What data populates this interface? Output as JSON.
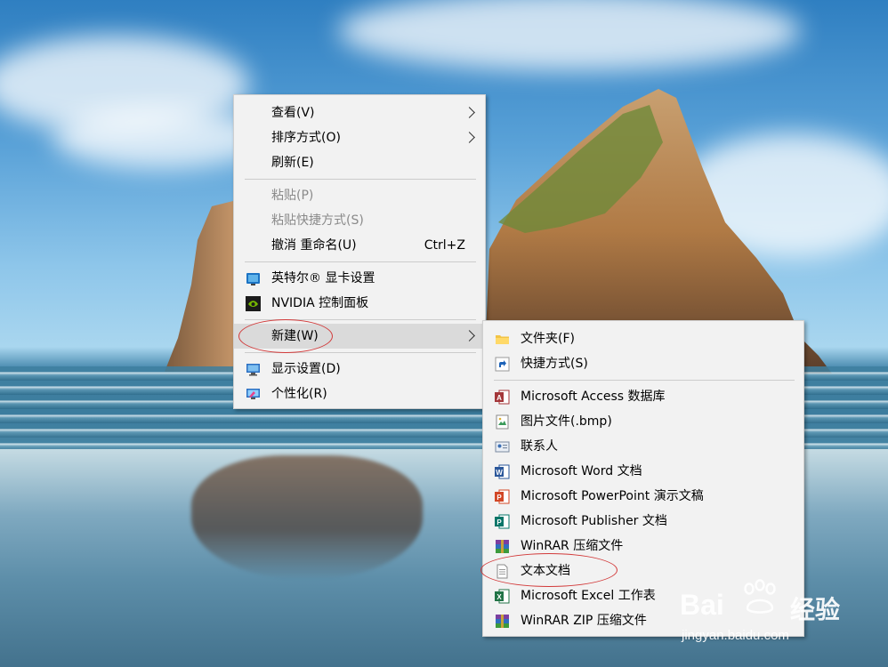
{
  "context_menu": {
    "items": [
      {
        "label": "查看(V)",
        "submenu": true
      },
      {
        "label": "排序方式(O)",
        "submenu": true
      },
      {
        "label": "刷新(E)"
      },
      {
        "label": "粘贴(P)",
        "disabled": true
      },
      {
        "label": "粘贴快捷方式(S)",
        "disabled": true
      },
      {
        "label": "撤消 重命名(U)",
        "shortcut": "Ctrl+Z"
      },
      {
        "label": "英特尔® 显卡设置",
        "icon": "intel-graphics-icon"
      },
      {
        "label": "NVIDIA 控制面板",
        "icon": "nvidia-icon"
      },
      {
        "label": "新建(W)",
        "submenu": true,
        "highlighted": true
      },
      {
        "label": "显示设置(D)",
        "icon": "display-settings-icon"
      },
      {
        "label": "个性化(R)",
        "icon": "personalize-icon"
      }
    ]
  },
  "new_submenu": {
    "items": [
      {
        "label": "文件夹(F)",
        "icon": "folder-icon"
      },
      {
        "label": "快捷方式(S)",
        "icon": "shortcut-icon"
      },
      {
        "label": "Microsoft Access 数据库",
        "icon": "access-icon"
      },
      {
        "label": "图片文件(.bmp)",
        "icon": "bmp-image-icon"
      },
      {
        "label": "联系人",
        "icon": "contact-icon"
      },
      {
        "label": "Microsoft Word 文档",
        "icon": "word-icon"
      },
      {
        "label": "Microsoft PowerPoint 演示文稿",
        "icon": "powerpoint-icon"
      },
      {
        "label": "Microsoft Publisher 文档",
        "icon": "publisher-icon"
      },
      {
        "label": "WinRAR 压缩文件",
        "icon": "winrar-icon"
      },
      {
        "label": "文本文档",
        "icon": "text-document-icon"
      },
      {
        "label": "Microsoft Excel 工作表",
        "icon": "excel-icon"
      },
      {
        "label": "WinRAR ZIP 压缩文件",
        "icon": "winrar-zip-icon"
      }
    ]
  },
  "watermark": {
    "brand": "Bai",
    "brand2": "经验",
    "url": "jingyan.baidu.com"
  },
  "colors": {
    "menu_bg": "#f2f2f2",
    "highlight": "#dadada",
    "annotation": "#d23a3a"
  }
}
